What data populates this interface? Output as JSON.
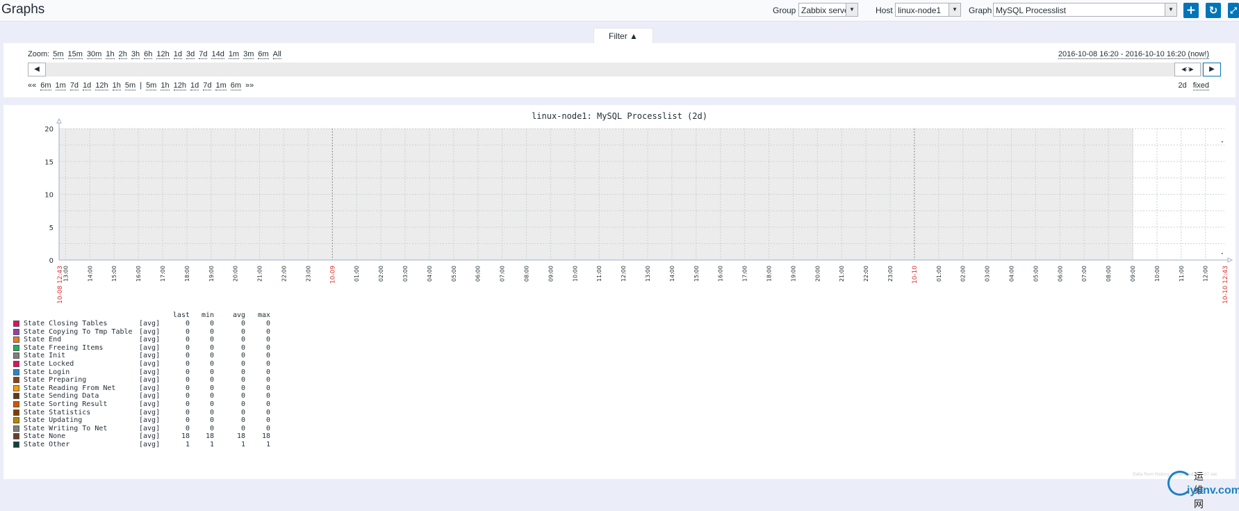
{
  "header": {
    "title": "Graphs",
    "group_label": "Group",
    "group_value": "Zabbix servers",
    "host_label": "Host",
    "host_value": "linux-node1",
    "graph_label": "Graph",
    "graph_value": "MySQL Processlist",
    "buttons": {
      "add_icon": "plus-icon",
      "refresh_icon": "refresh-icon",
      "fullscreen_icon": "fullscreen-icon"
    }
  },
  "filter": {
    "tab_label": "Filter ▲",
    "zoom_label": "Zoom:",
    "zoom_options": [
      "5m",
      "15m",
      "30m",
      "1h",
      "2h",
      "3h",
      "6h",
      "12h",
      "1d",
      "3d",
      "7d",
      "14d",
      "1m",
      "3m",
      "6m",
      "All"
    ],
    "date_range": "2016-10-08 16:20 - 2016-10-10 16:20 (now!)",
    "nav_back_marker": "««",
    "nav_back_options": [
      "6m",
      "1m",
      "7d",
      "1d",
      "12h",
      "1h",
      "5m"
    ],
    "nav_separator": "|",
    "nav_fwd_options": [
      "5m",
      "1h",
      "12h",
      "1d",
      "7d",
      "1m",
      "6m"
    ],
    "nav_fwd_marker": "»»",
    "period_value": "2d",
    "period_mode": "fixed"
  },
  "graph": {
    "title": "linux-node1: MySQL Processlist (2d)",
    "y_ticks": [
      "20",
      "15",
      "10",
      "5",
      "0"
    ],
    "x_start_label": "10-08 12:43",
    "x_end_label": "10-10 12:43",
    "x_hour_labels": [
      "13:00",
      "14:00",
      "15:00",
      "16:00",
      "17:00",
      "18:00",
      "19:00",
      "20:00",
      "21:00",
      "22:00",
      "23:00",
      "10-09",
      "01:00",
      "02:00",
      "03:00",
      "04:00",
      "05:00",
      "06:00",
      "07:00",
      "08:00",
      "09:00",
      "10:00",
      "11:00",
      "12:00",
      "13:00",
      "14:00",
      "15:00",
      "16:00",
      "17:00",
      "18:00",
      "19:00",
      "20:00",
      "21:00",
      "22:00",
      "23:00",
      "10-10",
      "01:00",
      "02:00",
      "03:00",
      "04:00",
      "05:00",
      "06:00",
      "07:00",
      "08:00",
      "09:00",
      "10:00",
      "11:00",
      "12:00"
    ],
    "data_from_note": "Data from history. Generated in 0.07 sec"
  },
  "legend": {
    "headers": [
      "last",
      "min",
      "avg",
      "max"
    ],
    "items": [
      {
        "name": "State Closing Tables",
        "func": "[avg]",
        "last": "0",
        "min": "0",
        "avg": "0",
        "max": "0",
        "color": "#e0115f"
      },
      {
        "name": "State Copying To Tmp Table",
        "func": "[avg]",
        "last": "0",
        "min": "0",
        "avg": "0",
        "max": "0",
        "color": "#8e44ad"
      },
      {
        "name": "State End",
        "func": "[avg]",
        "last": "0",
        "min": "0",
        "avg": "0",
        "max": "0",
        "color": "#e67e22"
      },
      {
        "name": "State Freeing Items",
        "func": "[avg]",
        "last": "0",
        "min": "0",
        "avg": "0",
        "max": "0",
        "color": "#27ae60"
      },
      {
        "name": "State Init",
        "func": "[avg]",
        "last": "0",
        "min": "0",
        "avg": "0",
        "max": "0",
        "color": "#7f7f7f"
      },
      {
        "name": "State Locked",
        "func": "[avg]",
        "last": "0",
        "min": "0",
        "avg": "0",
        "max": "0",
        "color": "#e0115f"
      },
      {
        "name": "State Login",
        "func": "[avg]",
        "last": "0",
        "min": "0",
        "avg": "0",
        "max": "0",
        "color": "#2e86c1"
      },
      {
        "name": "State Preparing",
        "func": "[avg]",
        "last": "0",
        "min": "0",
        "avg": "0",
        "max": "0",
        "color": "#8b4513"
      },
      {
        "name": "State Reading From Net",
        "func": "[avg]",
        "last": "0",
        "min": "0",
        "avg": "0",
        "max": "0",
        "color": "#f39c12"
      },
      {
        "name": "State Sending Data",
        "func": "[avg]",
        "last": "0",
        "min": "0",
        "avg": "0",
        "max": "0",
        "color": "#5d3a1a"
      },
      {
        "name": "State Sorting Result",
        "func": "[avg]",
        "last": "0",
        "min": "0",
        "avg": "0",
        "max": "0",
        "color": "#d35400"
      },
      {
        "name": "State Statistics",
        "func": "[avg]",
        "last": "0",
        "min": "0",
        "avg": "0",
        "max": "0",
        "color": "#7b3f00"
      },
      {
        "name": "State Updating",
        "func": "[avg]",
        "last": "0",
        "min": "0",
        "avg": "0",
        "max": "0",
        "color": "#b8860b"
      },
      {
        "name": "State Writing To Net",
        "func": "[avg]",
        "last": "0",
        "min": "0",
        "avg": "0",
        "max": "0",
        "color": "#808080"
      },
      {
        "name": "State None",
        "func": "[avg]",
        "last": "18",
        "min": "18",
        "avg": "18",
        "max": "18",
        "color": "#6b3e26"
      },
      {
        "name": "State Other",
        "func": "[avg]",
        "last": "1",
        "min": "1",
        "avg": "1",
        "max": "1",
        "color": "#17403c"
      }
    ]
  },
  "chart_data": {
    "type": "line",
    "title": "linux-node1: MySQL Processlist (2d)",
    "xlabel": "",
    "ylabel": "",
    "ylim": [
      0,
      20
    ],
    "x_range": [
      "2016-10-08 12:43",
      "2016-10-10 12:43"
    ],
    "grid": true,
    "series": [
      {
        "name": "State None",
        "x": [
          "2016-10-10 12:40"
        ],
        "values": [
          18
        ]
      },
      {
        "name": "State Other",
        "x": [
          "2016-10-10 12:40"
        ],
        "values": [
          1
        ]
      }
    ]
  },
  "watermark": {
    "top": "运维网",
    "bottom": "iyunv.com"
  }
}
